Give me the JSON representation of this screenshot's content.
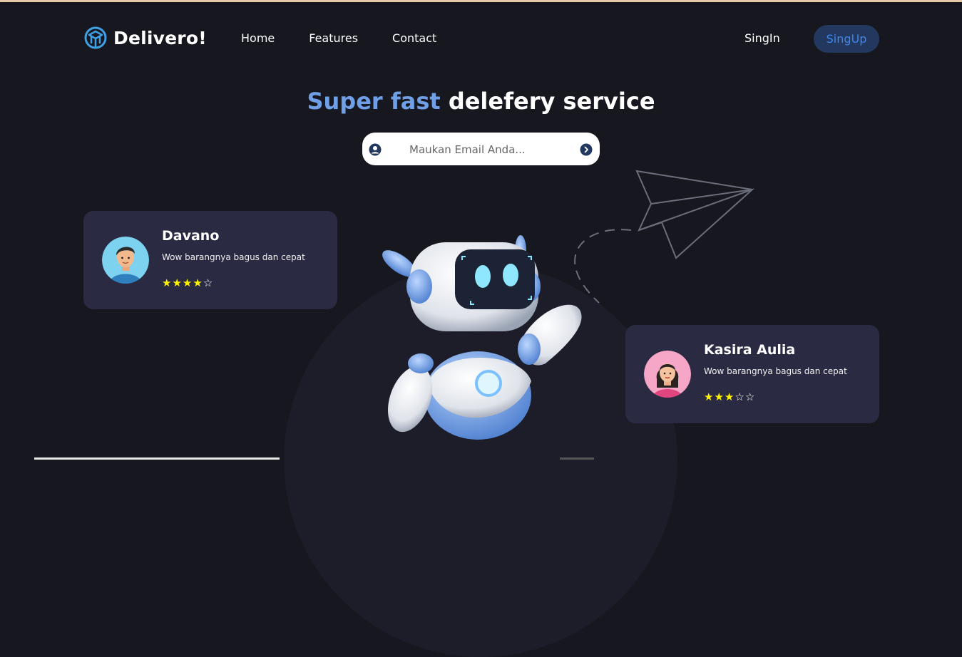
{
  "brand": {
    "name": "Delivero!",
    "icon": "box-logo-icon"
  },
  "nav": {
    "items": [
      "Home",
      "Features",
      "Contact"
    ]
  },
  "auth": {
    "signin_label": "SingIn",
    "signup_label": "SingUp"
  },
  "hero": {
    "title_accent": "Super fast",
    "title_rest": "delefery service"
  },
  "email": {
    "placeholder": "Maukan Email Anda...",
    "value": "",
    "leading_icon": "user-circle-icon",
    "submit_icon": "arrow-right-circle-icon"
  },
  "reviews": [
    {
      "name": "Davano",
      "text": "Wow barangnya bagus dan cepat",
      "rating": 4,
      "max": 5,
      "avatar": "man-avatar"
    },
    {
      "name": "Kasira Aulia",
      "text": "Wow barangnya bagus dan cepat",
      "rating": 3,
      "max": 5,
      "avatar": "woman-avatar"
    }
  ],
  "colors": {
    "background": "#16171f",
    "accent": "#6f9fe7",
    "card": "#2a2a42",
    "star": "#fff200",
    "signup_bg": "#22385e",
    "signup_text": "#3f86ee"
  }
}
